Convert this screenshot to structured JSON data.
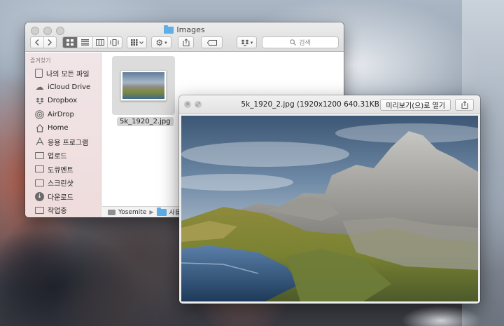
{
  "finder": {
    "title": "Images",
    "search_placeholder": "검색",
    "sidebar_heading": "즐겨찾기",
    "sidebar_items": [
      {
        "label": "나의 모든 파일",
        "icon": "all-files-icon"
      },
      {
        "label": "iCloud Drive",
        "icon": "icloud-icon"
      },
      {
        "label": "Dropbox",
        "icon": "dropbox-icon"
      },
      {
        "label": "AirDrop",
        "icon": "airdrop-icon"
      },
      {
        "label": "Home",
        "icon": "home-icon"
      },
      {
        "label": "응용 프로그램",
        "icon": "applications-icon"
      },
      {
        "label": "업로드",
        "icon": "folder-icon"
      },
      {
        "label": "도큐멘트",
        "icon": "document-icon"
      },
      {
        "label": "스크린샷",
        "icon": "folder-icon"
      },
      {
        "label": "다운로드",
        "icon": "download-icon"
      },
      {
        "label": "작업중",
        "icon": "folder-icon"
      }
    ],
    "file": {
      "name": "5k_1920_2.jpg"
    },
    "pathbar": {
      "disk": "Yosemite",
      "folder": "사용자"
    }
  },
  "quicklook": {
    "title": "5k_1920_2.jpg (1920x1200 640.31KB)",
    "open_button": "미리보기(으)로 열기"
  },
  "colors": {
    "selected_segment": "#6f6f6f",
    "folder_blue": "#5eaee8",
    "sidebar_bg": "#eedada"
  }
}
